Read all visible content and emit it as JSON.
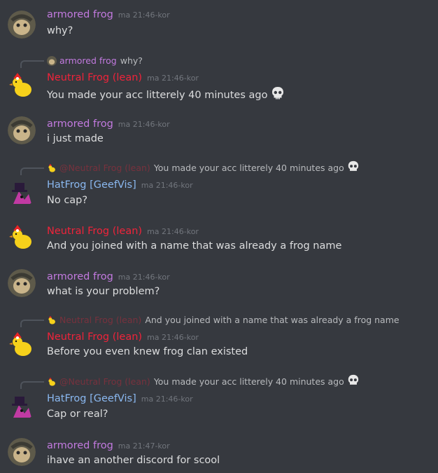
{
  "messages": [
    {
      "type": "message",
      "avatar": "frog-icon",
      "author": "armored frog",
      "author_color": "#c27adf",
      "timestamp": "ma 21:46-kor",
      "text": "why?"
    },
    {
      "type": "reply",
      "avatar": "chick-icon",
      "author": "Neutral Frog (lean)",
      "author_color": "#f0233a",
      "timestamp": "ma 21:46-kor",
      "text": "You made your acc litterely 40 minutes ago",
      "emoji": "skull-icon",
      "reply_to": {
        "avatar": "frog-icon",
        "author": "armored frog",
        "text": "why?"
      }
    },
    {
      "type": "message",
      "avatar": "frog-icon",
      "author": "armored frog",
      "author_color": "#c27adf",
      "timestamp": "ma 21:46-kor",
      "text": "i just made"
    },
    {
      "type": "reply",
      "avatar": "hat-icon",
      "author": "HatFrog [GeefVis]",
      "author_color": "#8ab8f0",
      "timestamp": "ma 21:46-kor",
      "text": "No cap?",
      "reply_to": {
        "avatar": "chick-icon",
        "author": "@Neutral Frog (lean)",
        "text": "You made your acc litterely 40 minutes ago",
        "emoji": "skull-icon"
      }
    },
    {
      "type": "message",
      "avatar": "chick-icon",
      "author": "Neutral Frog (lean)",
      "author_color": "#f0233a",
      "timestamp": "ma 21:46-kor",
      "text": "And you joined with a name that was already a frog name"
    },
    {
      "type": "message",
      "avatar": "frog-icon",
      "author": "armored frog",
      "author_color": "#c27adf",
      "timestamp": "ma 21:46-kor",
      "text": "what is your problem?"
    },
    {
      "type": "reply",
      "avatar": "chick-icon",
      "author": "Neutral Frog (lean)",
      "author_color": "#f0233a",
      "timestamp": "ma 21:46-kor",
      "text": "Before you even knew frog clan existed",
      "reply_to": {
        "avatar": "chick-icon",
        "author": "Neutral Frog (lean)",
        "text": "And you joined with a name that was already a frog name"
      }
    },
    {
      "type": "reply",
      "avatar": "hat-icon",
      "author": "HatFrog [GeefVis]",
      "author_color": "#8ab8f0",
      "timestamp": "ma 21:46-kor",
      "text": "Cap or real?",
      "reply_to": {
        "avatar": "chick-icon",
        "author": "@Neutral Frog (lean)",
        "text": "You made your acc litterely 40 minutes ago",
        "emoji": "skull-icon"
      }
    },
    {
      "type": "message",
      "avatar": "frog-icon",
      "author": "armored frog",
      "author_color": "#c27adf",
      "timestamp": "ma 21:47-kor",
      "text": "ihave an  another discord for scool"
    }
  ]
}
